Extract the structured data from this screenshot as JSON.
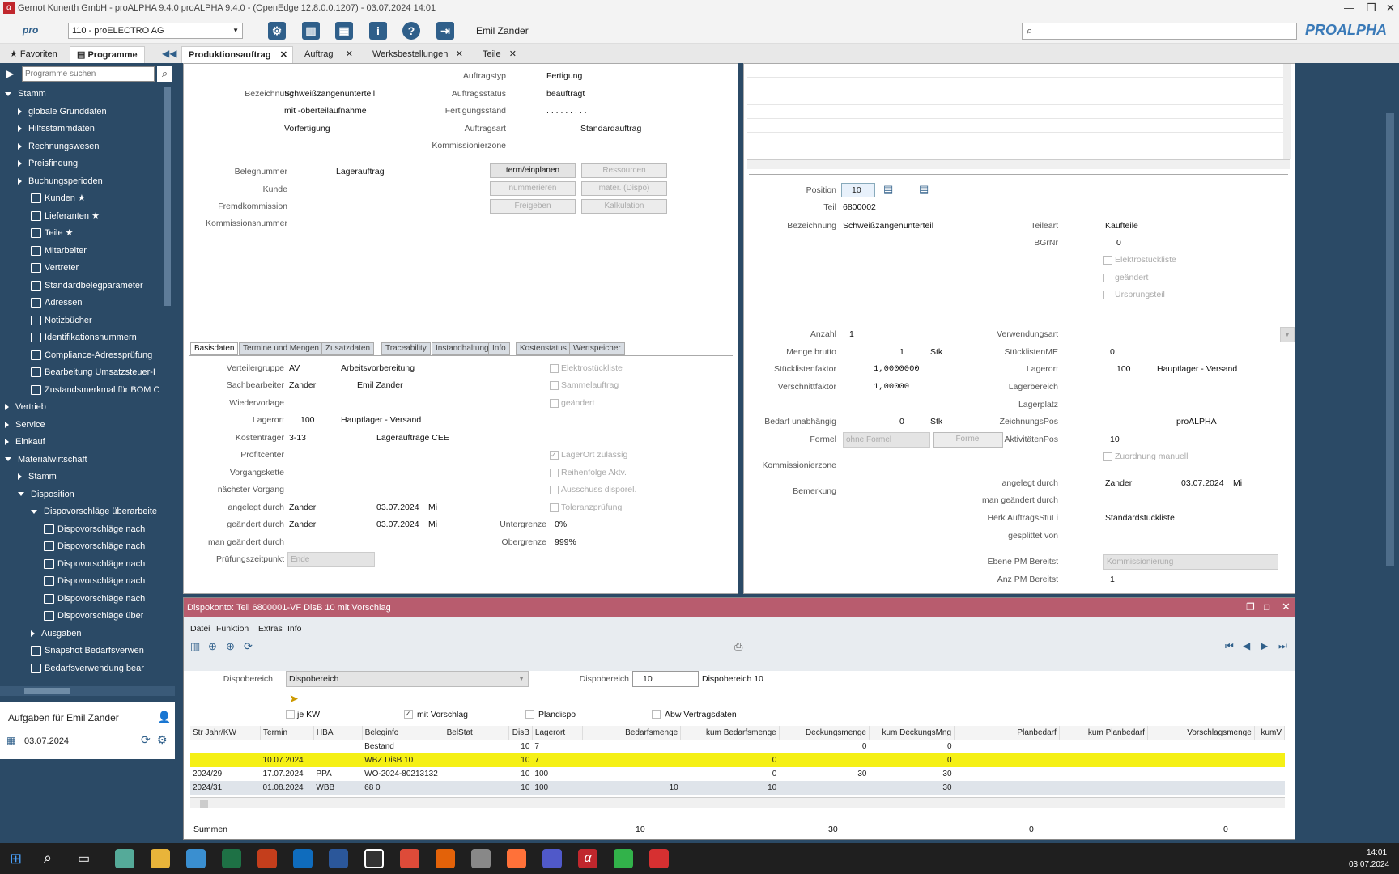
{
  "window": {
    "title": "Gernot Kunerth GmbH - proALPHA 9.4.0 proALPHA 9.4.0 - (OpenEdge 12.8.0.0.1207) - 03.07.2024 14:01"
  },
  "toolbar": {
    "company": "110 - proELECTRO AG",
    "user": "Emil Zander",
    "brand": "PROALPHA",
    "pro": "pro"
  },
  "nav_tabs": {
    "favoriten": "Favoriten",
    "programme": "Programme"
  },
  "doc_tabs": [
    "Produktionsauftrag",
    "Auftrag",
    "Werksbestellungen",
    "Teile"
  ],
  "sidebar": {
    "search_placeholder": "Programme suchen",
    "items": [
      {
        "label": "Stamm",
        "level": 0,
        "type": "open"
      },
      {
        "label": "globale Grunddaten",
        "level": 1,
        "type": "closed"
      },
      {
        "label": "Hilfsstammdaten",
        "level": 1,
        "type": "closed"
      },
      {
        "label": "Rechnungswesen",
        "level": 1,
        "type": "closed"
      },
      {
        "label": "Preisfindung",
        "level": 1,
        "type": "closed"
      },
      {
        "label": "Buchungsperioden",
        "level": 1,
        "type": "closed"
      },
      {
        "label": "Kunden",
        "level": 2,
        "type": "person",
        "star": true
      },
      {
        "label": "Lieferanten",
        "level": 2,
        "type": "truck",
        "star": true
      },
      {
        "label": "Teile",
        "level": 2,
        "type": "part",
        "star": true
      },
      {
        "label": "Mitarbeiter",
        "level": 2,
        "type": "person"
      },
      {
        "label": "Vertreter",
        "level": 2,
        "type": "win"
      },
      {
        "label": "Standardbelegparameter",
        "level": 2,
        "type": "win"
      },
      {
        "label": "Adressen",
        "level": 2,
        "type": "win"
      },
      {
        "label": "Notizbücher",
        "level": 2,
        "type": "win"
      },
      {
        "label": "Identifikationsnummern",
        "level": 2,
        "type": "win"
      },
      {
        "label": "Compliance-Adressprüfung",
        "level": 2,
        "type": "win"
      },
      {
        "label": "Bearbeitung Umsatzsteuer-I",
        "level": 2,
        "type": "win"
      },
      {
        "label": "Zustandsmerkmal für BOM C",
        "level": 2,
        "type": "win"
      },
      {
        "label": "Vertrieb",
        "level": 0,
        "type": "closed"
      },
      {
        "label": "Service",
        "level": 0,
        "type": "closed"
      },
      {
        "label": "Einkauf",
        "level": 0,
        "type": "closed"
      },
      {
        "label": "Materialwirtschaft",
        "level": 0,
        "type": "open"
      },
      {
        "label": "Stamm",
        "level": 1,
        "type": "closed"
      },
      {
        "label": "Disposition",
        "level": 1,
        "type": "open"
      },
      {
        "label": "Dispovorschläge überarbeite",
        "level": 2,
        "type": "open"
      },
      {
        "label": "Dispovorschläge nach",
        "level": 3,
        "type": "win"
      },
      {
        "label": "Dispovorschläge nach",
        "level": 3,
        "type": "win"
      },
      {
        "label": "Dispovorschläge nach",
        "level": 3,
        "type": "win"
      },
      {
        "label": "Dispovorschläge nach",
        "level": 3,
        "type": "win"
      },
      {
        "label": "Dispovorschläge nach",
        "level": 3,
        "type": "win"
      },
      {
        "label": "Dispovorschläge über",
        "level": 3,
        "type": "win"
      },
      {
        "label": "Ausgaben",
        "level": 2,
        "type": "closed"
      },
      {
        "label": "Snapshot Bedarfsverwen",
        "level": 2,
        "type": "win"
      },
      {
        "label": "Bedarfsverwendung bear",
        "level": 2,
        "type": "win"
      }
    ]
  },
  "tasks": {
    "title": "Aufgaben für Emil Zander",
    "date": "03.07.2024"
  },
  "order": {
    "bezeichnung_lbl": "Bezeichnung",
    "bezeichnung": [
      "Schweißzangenunterteil",
      "mit -oberteilaufnahme",
      "Vorfertigung"
    ],
    "auftragstyp_lbl": "Auftragstyp",
    "auftragstyp": "Fertigung",
    "auftragsstatus_lbl": "Auftragsstatus",
    "auftragsstatus": "beauftragt",
    "fertigungsstand_lbl": "Fertigungsstand",
    "fertigungsstand": ". . . . . . . . .",
    "auftragsart_lbl": "Auftragsart",
    "auftragsart": "Standardauftrag",
    "kommzone_lbl": "Kommissionierzone",
    "belegnummer_lbl": "Belegnummer",
    "belegnummer": "Lagerauftrag",
    "kunde_lbl": "Kunde",
    "fremdkomm_lbl": "Fremdkommission",
    "kommnr_lbl": "Kommissionsnummer",
    "buttons": [
      "term/einplanen",
      "Ressourcen",
      "nummerieren",
      "mater. (Dispo)",
      "Freigeben",
      "Kalkulation"
    ]
  },
  "subtabs": [
    "Basisdaten",
    "Termine und Mengen",
    "Zusatzdaten",
    "Traceability",
    "Instandhaltung",
    "Info",
    "Kostenstatus",
    "Wertspeicher"
  ],
  "basis": {
    "verteilergruppe_lbl": "Verteilergruppe",
    "verteilergruppe": "AV",
    "verteilergruppe_txt": "Arbeitsvorbereitung",
    "sachbearbeiter_lbl": "Sachbearbeiter",
    "sachbearbeiter": "Zander",
    "sachbearbeiter_txt": "Emil Zander",
    "wiedervorlage_lbl": "Wiedervorlage",
    "lagerort_lbl": "Lagerort",
    "lagerort": "100",
    "lagerort_txt": "Hauptlager - Versand",
    "kostentraeger_lbl": "Kostenträger",
    "kostentraeger": "3-13",
    "kostentraeger_txt": "Lageraufträge CEE",
    "profitcenter_lbl": "Profitcenter",
    "vorgangskette_lbl": "Vorgangskette",
    "naechster_lbl": "nächster Vorgang",
    "angelegt_lbl": "angelegt durch",
    "angelegt": "Zander",
    "angelegt_date": "03.07.2024",
    "angelegt_day": "Mi",
    "geaendert_lbl": "geändert durch",
    "geaendert": "Zander",
    "geaendert_date": "03.07.2024",
    "geaendert_day": "Mi",
    "mangeaendert_lbl": "man geändert durch",
    "pruefung_lbl": "Prüfungszeitpunkt",
    "pruefung": "Ende",
    "elektro": "Elektrostückliste",
    "sammel": "Sammelauftrag",
    "geaendert_cb": "geändert",
    "lagerort_zul": "LagerOrt zulässig",
    "reihenfolge": "Reihenfolge Aktv.",
    "ausschuss": "Ausschuss disporel.",
    "toleranz": "Toleranzprüfung",
    "untergrenze_lbl": "Untergrenze",
    "untergrenze": "0%",
    "obergrenze_lbl": "Obergrenze",
    "obergrenze": "999%"
  },
  "pos": {
    "position_lbl": "Position",
    "position": "10",
    "teil_lbl": "Teil",
    "teil": "6800002",
    "bez_lbl": "Bezeichnung",
    "bez": "Schweißzangenunterteil",
    "teileart_lbl": "Teileart",
    "teileart": "Kaufteile",
    "bgrnr_lbl": "BGrNr",
    "bgrnr": "0",
    "elektro": "Elektrostückliste",
    "geaendert": "geändert",
    "ursprung": "Ursprungsteil",
    "anzahl_lbl": "Anzahl",
    "anzahl": "1",
    "menge_lbl": "Menge brutto",
    "menge": "1",
    "menge_unit": "Stk",
    "faktor_lbl": "Stücklistenfaktor",
    "faktor": "1,0000000",
    "verschnitt_lbl": "Verschnittfaktor",
    "verschnitt": "1,00000",
    "bedarf_lbl": "Bedarf unabhängig",
    "bedarf": "0",
    "bedarf_unit": "Stk",
    "formel_lbl": "Formel",
    "formel": "ohne Formel",
    "formel_btn": "Formel",
    "kommzone_lbl": "Kommissionierzone",
    "bemerkung_lbl": "Bemerkung",
    "verwendung_lbl": "Verwendungsart",
    "stmeh_lbl": "StücklistenME",
    "stmeh": "0",
    "lagerort_lbl": "Lagerort",
    "lagerort": "100",
    "lagerort_txt": "Hauptlager - Versand",
    "lagerbereich_lbl": "Lagerbereich",
    "lagerplatz_lbl": "Lagerplatz",
    "zeichnung_lbl": "ZeichnungsPos",
    "zeichnung": "proALPHA",
    "aktiv_lbl": "AktivitätenPos",
    "aktiv": "10",
    "zuordnung": "Zuordnung manuell",
    "angelegt_lbl": "angelegt durch",
    "angelegt": "Zander",
    "angelegt_date": "03.07.2024",
    "angelegt_day": "Mi",
    "mangeaendert_lbl": "man geändert durch",
    "herk_lbl": "Herk AuftragsStüLi",
    "herk": "Standardstückliste",
    "gesplittet_lbl": "gesplittet von",
    "ebene_lbl": "Ebene PM Bereitst",
    "ebene": "Kommissionierung",
    "anz_lbl": "Anz PM Bereitst",
    "anz": "1"
  },
  "dispo": {
    "title": "Dispokonto: Teil 6800001-VF DisB 10 mit Vorschlag",
    "menu": [
      "Datei",
      "Funktion",
      "Extras",
      "Info"
    ],
    "dispobereich_lbl": "Dispobereich",
    "dispobereich_sel": "Dispobereich",
    "dispobereich2_lbl": "Dispobereich",
    "dispobereich_val": "10",
    "dispobereich_txt": "Dispobereich 10",
    "cb_jekw": "je KW",
    "cb_vorschlag": "mit Vorschlag",
    "cb_plandispo": "Plandispo",
    "cb_abw": "Abw Vertragsdaten",
    "columns": [
      "Str Jahr/KW",
      "Termin",
      "HBA",
      "Beleginfo",
      "BelStat",
      "DisB",
      "Lagerort",
      "Bedarfsmenge",
      "kum Bedarfsmenge",
      "Deckungsmenge",
      "kum DeckungsMng",
      "Planbedarf",
      "kum Planbedarf",
      "Vorschlagsmenge",
      "kumV"
    ],
    "rows": [
      [
        "",
        "",
        "",
        "Bestand",
        "",
        "10",
        "7",
        "",
        "",
        "0",
        "0",
        "",
        "",
        "",
        ""
      ],
      [
        "",
        "10.07.2024",
        "",
        "WBZ DisB 10",
        "",
        "10",
        "7",
        "",
        "0",
        "",
        "0",
        "",
        "",
        "",
        ""
      ],
      [
        "2024/29",
        "17.07.2024",
        "PPA",
        "WO-2024-80213132",
        "",
        "10",
        "100",
        "",
        "0",
        "30",
        "30",
        "",
        "",
        "",
        ""
      ],
      [
        "2024/31",
        "01.08.2024",
        "WBB",
        "68 0",
        "",
        "10",
        "100",
        "10",
        "10",
        "",
        "30",
        "",
        "",
        "",
        ""
      ]
    ],
    "summen_lbl": "Summen",
    "sum_bedarf": "10",
    "sum_deckung": "30",
    "sum_plan": "0",
    "sum_vorschlag": "0"
  },
  "taskbar": {
    "time": "14:01",
    "date": "03.07.2024"
  },
  "colors": {
    "sidebar": "#2b4a66",
    "dispo_header": "#b85c6e",
    "highlight": "#f5f015",
    "accent": "#2f5f8a"
  }
}
